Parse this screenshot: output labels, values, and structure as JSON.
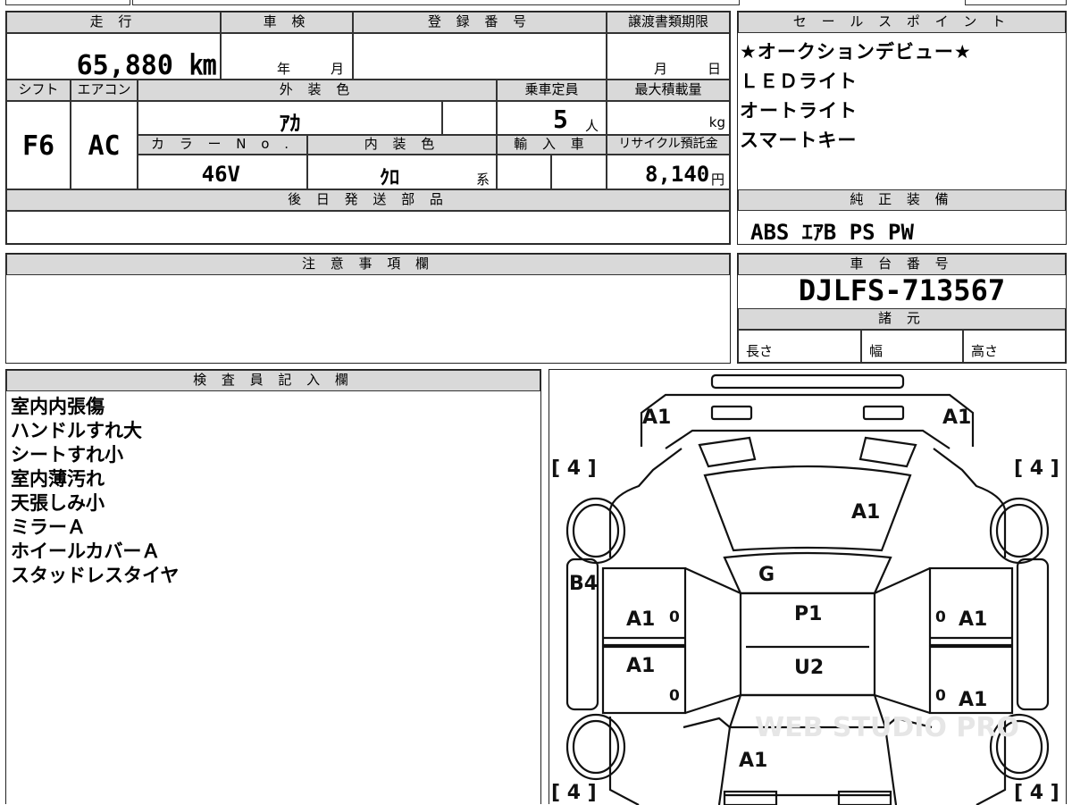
{
  "top": {
    "mileage_hdr": "走 行",
    "inspection_hdr": "車 検",
    "reg_hdr": "登 録 番 号",
    "transfer_hdr": "譲渡書類期限"
  },
  "mileage": "65,880 ㎞",
  "inspection": {
    "year": "年",
    "month": "月"
  },
  "transfer": {
    "month": "月",
    "day": "日"
  },
  "row2": {
    "shift_hdr": "シフト",
    "ac_hdr": "エアコン",
    "ext_hdr": "外 装 色",
    "capacity_hdr": "乗車定員",
    "load_hdr": "最大積載量"
  },
  "shift": "F6",
  "ac": "AC",
  "ext_color": "ｱｶ",
  "capacity": "5",
  "capacity_unit": "人",
  "load_unit": "kg",
  "row3": {
    "colorno_hdr": "カ ラ ー N o .",
    "int_hdr": "内 装 色",
    "import_hdr": "輸 入 車",
    "recycle_hdr": "リサイクル預託金"
  },
  "color_no": "46V",
  "int_color": "ｸﾛ",
  "int_suffix": "系",
  "recycle": "8,140",
  "recycle_unit": "円",
  "parts_hdr": "後 日 発 送 部 品",
  "sales_hdr": "セ ー ル ス ポ イ ン ト",
  "sales_points": [
    "★オークションデビュー★",
    "ＬＥＤライト",
    "オートライト",
    "スマートキー"
  ],
  "equip_hdr": "純 正 装 備",
  "equipment": "ABS ｴｱB PS PW",
  "caution_hdr": "注 意 事 項 欄",
  "chassis_hdr": "車 台 番 号",
  "chassis": "DJLFS-713567",
  "spec_hdr": "諸 元",
  "spec": {
    "length": "長さ",
    "width": "幅",
    "height": "高さ"
  },
  "inspector_hdr": "検 査 員 記 入 欄",
  "inspector_notes": [
    "室内内張傷",
    "ハンドルすれ大",
    "シートすれ小",
    "室内薄汚れ",
    "天張しみ小",
    "ミラーＡ",
    "ホイールカバーＡ",
    "スタッドレスタイヤ"
  ],
  "diagram": {
    "tl_tire": "[ 4 ]",
    "tr_tire": "[ 4 ]",
    "bl_tire": "[ 4 ]",
    "br_tire": "[ 4 ]",
    "front_left": "A1",
    "front_right": "A1",
    "hood": "A1",
    "windshield": "G",
    "left_fender": "B4",
    "roof1": "P1",
    "roof2": "U2",
    "rear": "A1",
    "ld1": "A1",
    "ld2": "A1",
    "rd1": "A1",
    "rd2": "A1",
    "z1": "0",
    "z2": "0",
    "z3": "0",
    "z4": "0",
    "watermark": "WEB STUDIO PRO"
  }
}
